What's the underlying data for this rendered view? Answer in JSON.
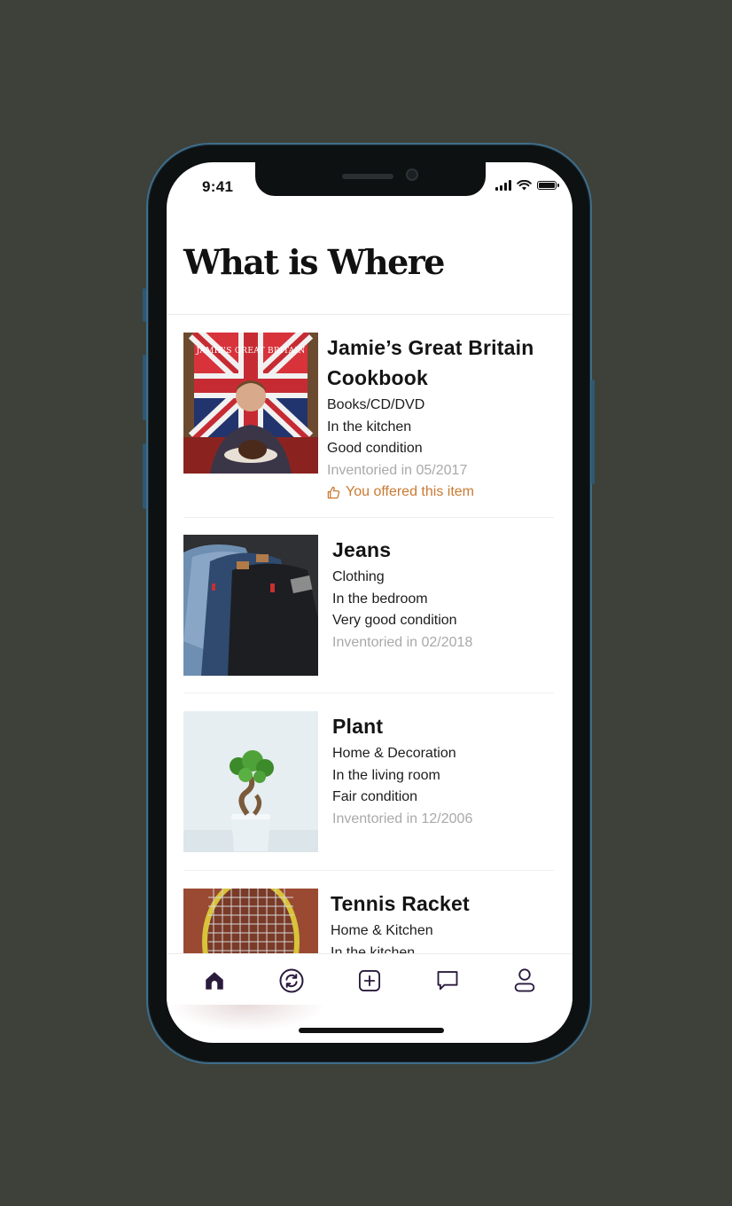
{
  "status_bar": {
    "time": "9:41"
  },
  "page": {
    "title": "What is Where"
  },
  "items": [
    {
      "title_line1": "Jamie’s Great Britain",
      "title_line2": "Cookbook",
      "category": "Books/CD/DVD",
      "location": "In the kitchen",
      "condition": "Good condition",
      "inventoried": "Inventoried in 05/2017",
      "offer": "You offered this item",
      "cover_text": "JAMIE'S GREAT BRITAIN"
    },
    {
      "title": "Jeans",
      "category": "Clothing",
      "location": "In the bedroom",
      "condition": "Very good condition",
      "inventoried": "Inventoried in 02/2018"
    },
    {
      "title": "Plant",
      "category": "Home & Decoration",
      "location": "In the living room",
      "condition": "Fair condition",
      "inventoried": "Inventoried in 12/2006"
    },
    {
      "title": "Tennis Racket",
      "category": "Home & Kitchen",
      "location": "In the kitchen"
    }
  ],
  "tabs": [
    {
      "name": "home",
      "icon": "home-icon",
      "active": true
    },
    {
      "name": "exchange",
      "icon": "refresh-icon",
      "active": false
    },
    {
      "name": "add",
      "icon": "plus-square-icon",
      "active": false
    },
    {
      "name": "messages",
      "icon": "chat-icon",
      "active": false
    },
    {
      "name": "profile",
      "icon": "user-icon",
      "active": false
    }
  ],
  "colors": {
    "accent": "#c97a32",
    "tab_active": "#2a1b3d",
    "background": "#3d413a"
  }
}
